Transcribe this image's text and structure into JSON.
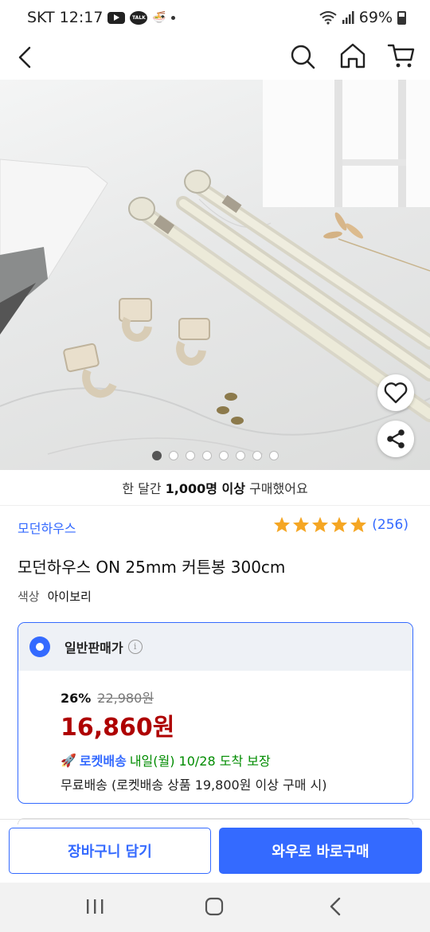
{
  "status_bar": {
    "carrier": "SKT",
    "time": "12:17",
    "battery": "69%"
  },
  "header": {
    "icons": [
      "back-arrow-icon",
      "search-icon",
      "home-icon",
      "cart-icon"
    ]
  },
  "gallery": {
    "total_images": 8,
    "current_index": 1,
    "action_icons": [
      "heart-icon",
      "share-icon"
    ]
  },
  "product": {
    "sold_prefix": "한 달간 ",
    "sold_bold": "1,000명 이상",
    "sold_suffix": " 구매했어요",
    "brand": "모던하우스",
    "rating_stars": 5,
    "review_count": "(256)",
    "title": "모던하우스 ON 25mm 커튼봉 300cm",
    "option_label": "색상",
    "option_value": "아이보리"
  },
  "price": {
    "type_label": "일반판매가",
    "discount_rate": "26%",
    "original_price": "22,980원",
    "final_price": "16,860원",
    "rocket_label": "로켓배송",
    "delivery_estimate": "내일(월) 10/28 도착 보장",
    "free_shipping": "무료배송 (로켓배송 상품 19,800원 이상 구매 시)"
  },
  "actions": {
    "cart_label": "장바구니 담기",
    "buy_label": "와우로 바로구매"
  },
  "colors": {
    "accent": "#346aff",
    "price_red": "#ae0000",
    "delivery_green": "#008c00",
    "star": "#f5a623"
  }
}
